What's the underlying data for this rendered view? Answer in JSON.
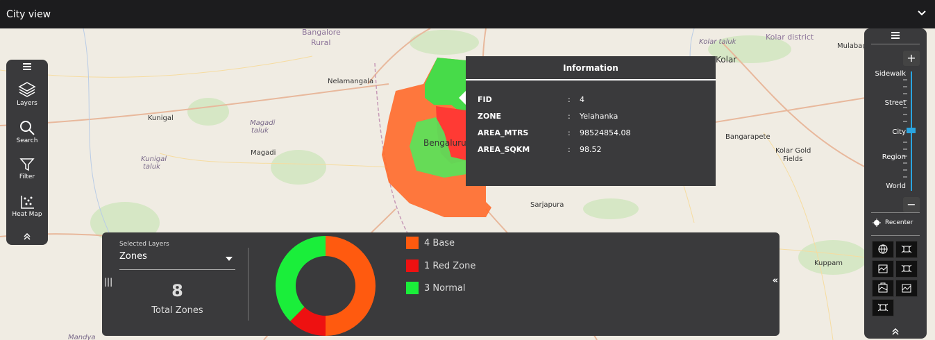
{
  "window": {
    "title": "City view"
  },
  "map_labels": [
    {
      "text": "Bangalore",
      "kind": "purple"
    },
    {
      "text": "Rural",
      "kind": "purple"
    },
    {
      "text": "Kolar district",
      "kind": "purple"
    },
    {
      "text": "Kolar taluk",
      "kind": "it"
    },
    {
      "text": "Mulabag",
      "kind": "plain"
    },
    {
      "text": "Kolar",
      "kind": "plain"
    },
    {
      "text": "Nelamangala",
      "kind": "plain"
    },
    {
      "text": "Kunigal",
      "kind": "plain"
    },
    {
      "text": "Magadi",
      "kind": "it"
    },
    {
      "text": "taluk",
      "kind": "it"
    },
    {
      "text": "Magadi",
      "kind": "plain"
    },
    {
      "text": "Kunigal",
      "kind": "it"
    },
    {
      "text": "taluk",
      "kind": "it"
    },
    {
      "text": "Bangarapete",
      "kind": "plain"
    },
    {
      "text": "Kolar Gold",
      "kind": "plain"
    },
    {
      "text": "Fields",
      "kind": "plain"
    },
    {
      "text": "Sarjapura",
      "kind": "plain"
    },
    {
      "text": "Kuppam",
      "kind": "plain"
    },
    {
      "text": "Bengaluru",
      "kind": "plain"
    },
    {
      "text": "Mandya",
      "kind": "it"
    }
  ],
  "left_toolbar": {
    "menu_icon": "hamburger-icon",
    "items": [
      {
        "label": "Layers",
        "icon": "layers-icon"
      },
      {
        "label": "Search",
        "icon": "search-icon"
      },
      {
        "label": "Filter",
        "icon": "filter-icon"
      },
      {
        "label": "Heat Map",
        "icon": "heatmap-icon"
      }
    ],
    "collapse_icon": "double-chevron-up-icon"
  },
  "right_toolbar": {
    "zoom_in": "+",
    "zoom_out": "−",
    "zoom_levels": [
      "Sidewalk",
      "Street",
      "City",
      "Region",
      "World"
    ],
    "current_level": "City",
    "recenter_label": "Recenter",
    "basemaps": [
      "globe-icon",
      "satellite-icon",
      "terrain-icon",
      "satellite-icon",
      "terrain-icon",
      "terrain-icon",
      "satellite-icon"
    ],
    "collapse_icon": "double-chevron-up-icon"
  },
  "info_popup": {
    "title": "Information",
    "rows": [
      {
        "key": "FID",
        "value": "4"
      },
      {
        "key": "ZONE",
        "value": "Yelahanka"
      },
      {
        "key": "AREA_MTRS",
        "value": "98524854.08"
      },
      {
        "key": "AREA_SQKM",
        "value": "98.52"
      }
    ]
  },
  "bottom_panel": {
    "selected_layers_label": "Selected Layers",
    "selected_layer": "Zones",
    "total_count": "8",
    "total_label": "Total Zones",
    "legend": [
      {
        "label": "4 Base",
        "color": "#ff5a0f"
      },
      {
        "label": "1 Red Zone",
        "color": "#ee1111"
      },
      {
        "label": "3 Normal",
        "color": "#1aee3a"
      }
    ]
  },
  "chart_data": {
    "type": "pie",
    "donut": true,
    "categories": [
      "Base",
      "Red Zone",
      "Normal"
    ],
    "values": [
      4,
      1,
      3
    ],
    "colors": [
      "#ff5a0f",
      "#ee1111",
      "#1aee3a"
    ]
  }
}
